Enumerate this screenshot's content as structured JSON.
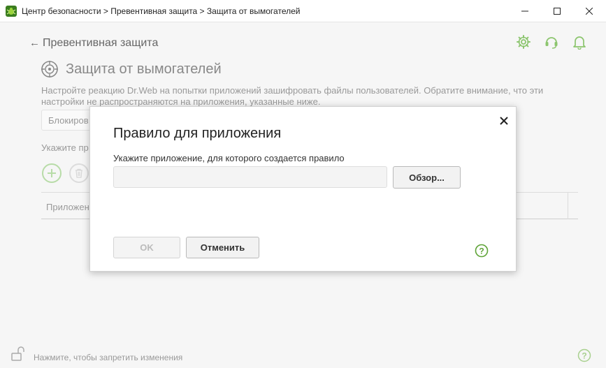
{
  "window": {
    "title": "Центр безопасности > Превентивная защита > Защита от вымогателей",
    "controls": [
      "minimize",
      "maximize",
      "close"
    ]
  },
  "header": {
    "back_label": "Превентивная защита",
    "icons": [
      "gear-icon",
      "headset-icon",
      "bell-icon"
    ]
  },
  "section": {
    "title": "Защита от вымогателей",
    "description": "Настройте реакцию Dr.Web на попытки приложений зашифровать файлы пользователей. Обратите внимание, что эти настройки не распространяются на приложения, указанные ниже.",
    "action_select_value": "Блокиров",
    "apps_hint": "Укажите пр",
    "table_header": "Приложен"
  },
  "footer": {
    "lock_text": "Нажмите, чтобы запретить изменения"
  },
  "dialog": {
    "title": "Правило для приложения",
    "label": "Укажите приложение, для которого создается правило",
    "input_value": "",
    "browse_label": "Обзор...",
    "ok_label": "OK",
    "cancel_label": "Отменить"
  },
  "colors": {
    "accent_green": "#6aa84f",
    "muted_green": "#b8dca8"
  }
}
